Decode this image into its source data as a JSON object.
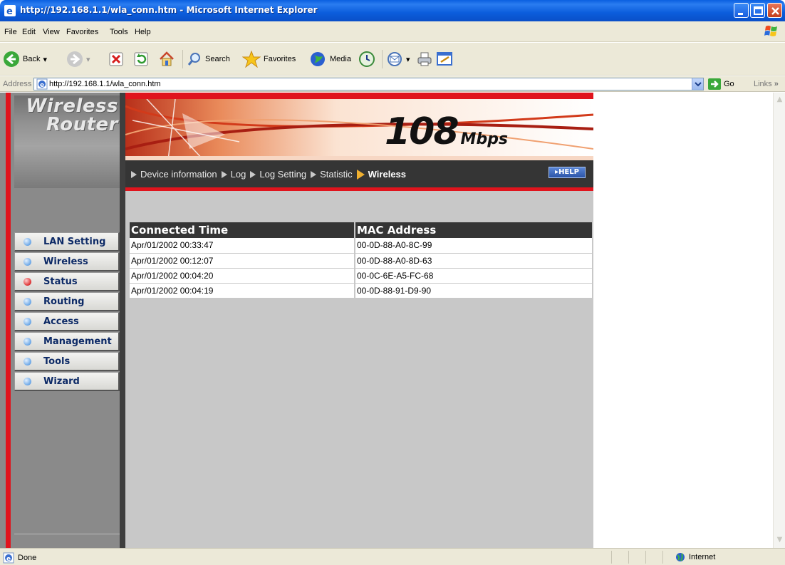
{
  "window": {
    "title": "http://192.168.1.1/wla_conn.htm - Microsoft Internet Explorer",
    "icon": "ie-icon"
  },
  "menu": [
    {
      "label": "File"
    },
    {
      "label": "Edit"
    },
    {
      "label": "View"
    },
    {
      "label": "Favorites"
    },
    {
      "label": "Tools"
    },
    {
      "label": "Help"
    }
  ],
  "toolbar": {
    "back_label": "Back",
    "search_label": "Search",
    "favorites_label": "Favorites",
    "media_label": "Media"
  },
  "address": {
    "label": "Address",
    "url": "http://192.168.1.1/wla_conn.htm",
    "go_label": "Go",
    "links_label": "Links"
  },
  "router": {
    "logo_line1": "Wireless",
    "logo_line2": "Router",
    "speed_value": "108",
    "speed_unit": "Mbps",
    "help_label": "HELP",
    "accent_red": "#e0141d",
    "tabs": [
      {
        "label": "Device information",
        "active": false
      },
      {
        "label": "Log",
        "active": false
      },
      {
        "label": "Log Setting",
        "active": false
      },
      {
        "label": "Statistic",
        "active": false
      },
      {
        "label": "Wireless",
        "active": true
      }
    ],
    "nav": [
      {
        "label": "LAN Setting",
        "active": false
      },
      {
        "label": "Wireless",
        "active": false
      },
      {
        "label": "Status",
        "active": true
      },
      {
        "label": "Routing",
        "active": false
      },
      {
        "label": "Access",
        "active": false
      },
      {
        "label": "Management",
        "active": false
      },
      {
        "label": "Tools",
        "active": false
      },
      {
        "label": "Wizard",
        "active": false
      }
    ]
  },
  "connections": {
    "headers": [
      "Connected Time",
      "MAC Address"
    ],
    "rows": [
      [
        "Apr/01/2002 00:33:47",
        "00-0D-88-A0-8C-99"
      ],
      [
        "Apr/01/2002 00:12:07",
        "00-0D-88-A0-8D-63"
      ],
      [
        "Apr/01/2002 00:04:20",
        "00-0C-6E-A5-FC-68"
      ],
      [
        "Apr/01/2002 00:04:19",
        "00-0D-88-91-D9-90"
      ]
    ]
  },
  "status": {
    "text": "Done",
    "zone": "Internet"
  }
}
